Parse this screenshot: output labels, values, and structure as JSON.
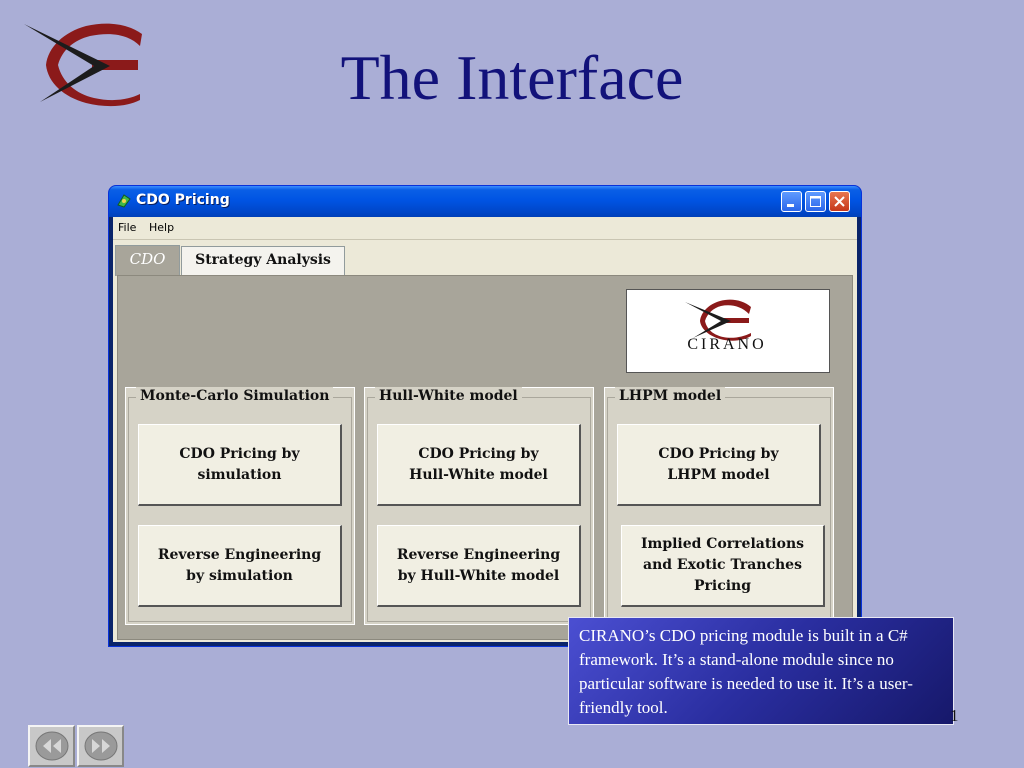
{
  "slide": {
    "title": "The Interface",
    "page_number": "1",
    "note": "CIRANO’s CDO pricing module is built in a C# framework. It’s a stand-alone module since no particular software is needed to use it. It’s a user-friendly tool."
  },
  "window": {
    "title": "CDO Pricing",
    "menu": [
      "File",
      "Help"
    ],
    "tabs": [
      {
        "label": "CDO",
        "selected": true
      },
      {
        "label": "Strategy Analysis",
        "selected": false
      }
    ],
    "logo_text": "CIRANO",
    "groups": [
      {
        "title": "Monte-Carlo Simulation",
        "buttons": [
          "CDO Pricing by\nsimulation",
          "Reverse Engineering\nby simulation"
        ]
      },
      {
        "title": "Hull-White model",
        "buttons": [
          "CDO Pricing  by\nHull-White model",
          "Reverse Engineering\nby Hull-White model"
        ]
      },
      {
        "title": "LHPM model",
        "buttons": [
          "CDO Pricing by\nLHPM model",
          "Implied Correlations\nand Exotic Tranches\nPricing"
        ]
      }
    ]
  },
  "icons": {
    "slide_logo": "cirano-logo-icon",
    "app": "app-icon",
    "minimize": "minimize-icon",
    "maximize": "maximize-icon",
    "close": "close-icon",
    "prev": "rewind-icon",
    "next": "fast-forward-icon"
  },
  "colors": {
    "slide_background": "#aaaed6",
    "title_color": "#12127a",
    "logo_red": "#8b1a1a",
    "titlebar_blue": "#0054e3"
  }
}
